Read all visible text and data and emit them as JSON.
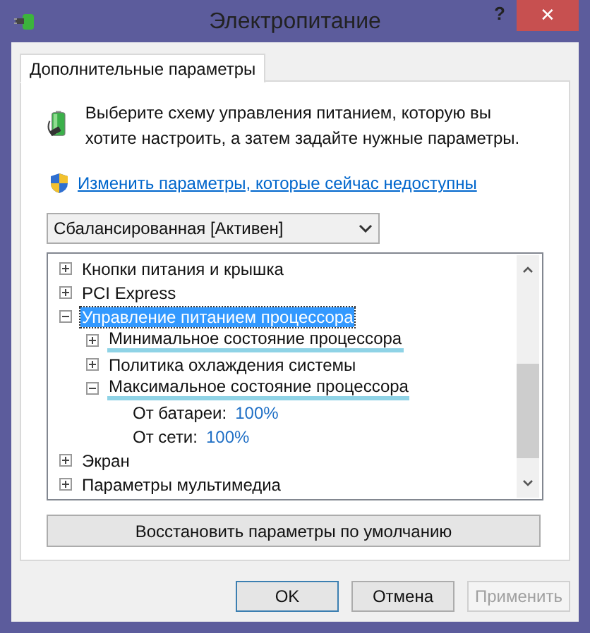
{
  "window": {
    "title": "Электропитание",
    "help": "?",
    "close": "✕"
  },
  "tabs": [
    {
      "label": "Дополнительные параметры",
      "selected": true
    }
  ],
  "intro": "Выберите схему управления питанием, которую вы хотите настроить, а затем задайте нужные параметры.",
  "admin_link": "Изменить параметры, которые сейчас недоступны",
  "plan_dropdown": {
    "value": "Сбалансированная [Активен]"
  },
  "tree": [
    {
      "label": "Кнопки питания и крышка",
      "expanded": false,
      "selected": false,
      "highlighted": false
    },
    {
      "label": "PCI Express",
      "expanded": false,
      "selected": false,
      "highlighted": false
    },
    {
      "label": "Управление питанием процессора",
      "expanded": true,
      "selected": true,
      "highlighted": false,
      "children": [
        {
          "label": "Минимальное состояние процессора",
          "expanded": false,
          "selected": false,
          "highlighted": true
        },
        {
          "label": "Политика охлаждения системы",
          "expanded": false,
          "selected": false,
          "highlighted": false
        },
        {
          "label": "Максимальное состояние процессора",
          "expanded": true,
          "selected": false,
          "highlighted": true,
          "children": [
            {
              "kind": "value",
              "label": "От батареи:",
              "value": "100%"
            },
            {
              "kind": "value",
              "label": "От сети:",
              "value": "100%"
            }
          ]
        }
      ]
    },
    {
      "label": "Экран",
      "expanded": false,
      "selected": false,
      "highlighted": false
    },
    {
      "label": "Параметры мультимедиа",
      "expanded": false,
      "selected": false,
      "highlighted": false
    }
  ],
  "restore_button": {
    "label": "Восстановить параметры по умолчанию"
  },
  "buttons": [
    {
      "label": "OK",
      "default": true,
      "disabled": false
    },
    {
      "label": "Отмена",
      "default": false,
      "disabled": false
    },
    {
      "label": "Применить",
      "default": false,
      "disabled": true
    }
  ]
}
